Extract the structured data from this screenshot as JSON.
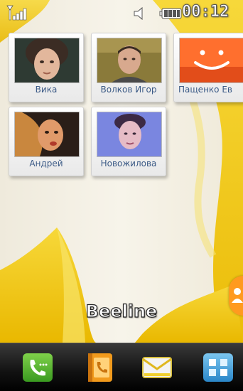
{
  "status_bar": {
    "clock": "00:12",
    "icons": [
      "signal-icon",
      "volume-icon",
      "battery-icon"
    ]
  },
  "contacts": [
    {
      "name": "Вика"
    },
    {
      "name": "Волков Игор"
    },
    {
      "name": "Пащенко Ев"
    },
    {
      "name": "Андрей"
    },
    {
      "name": "Новожилова"
    }
  ],
  "operator": "Beeline",
  "dock": [
    "phone-icon",
    "contacts-book-icon",
    "messages-icon",
    "menu-grid-icon"
  ],
  "colors": {
    "wallpaper_yellow": "#f2cc1c",
    "accent_orange": "#ff9a1f",
    "name_text": "#3b5a86"
  }
}
